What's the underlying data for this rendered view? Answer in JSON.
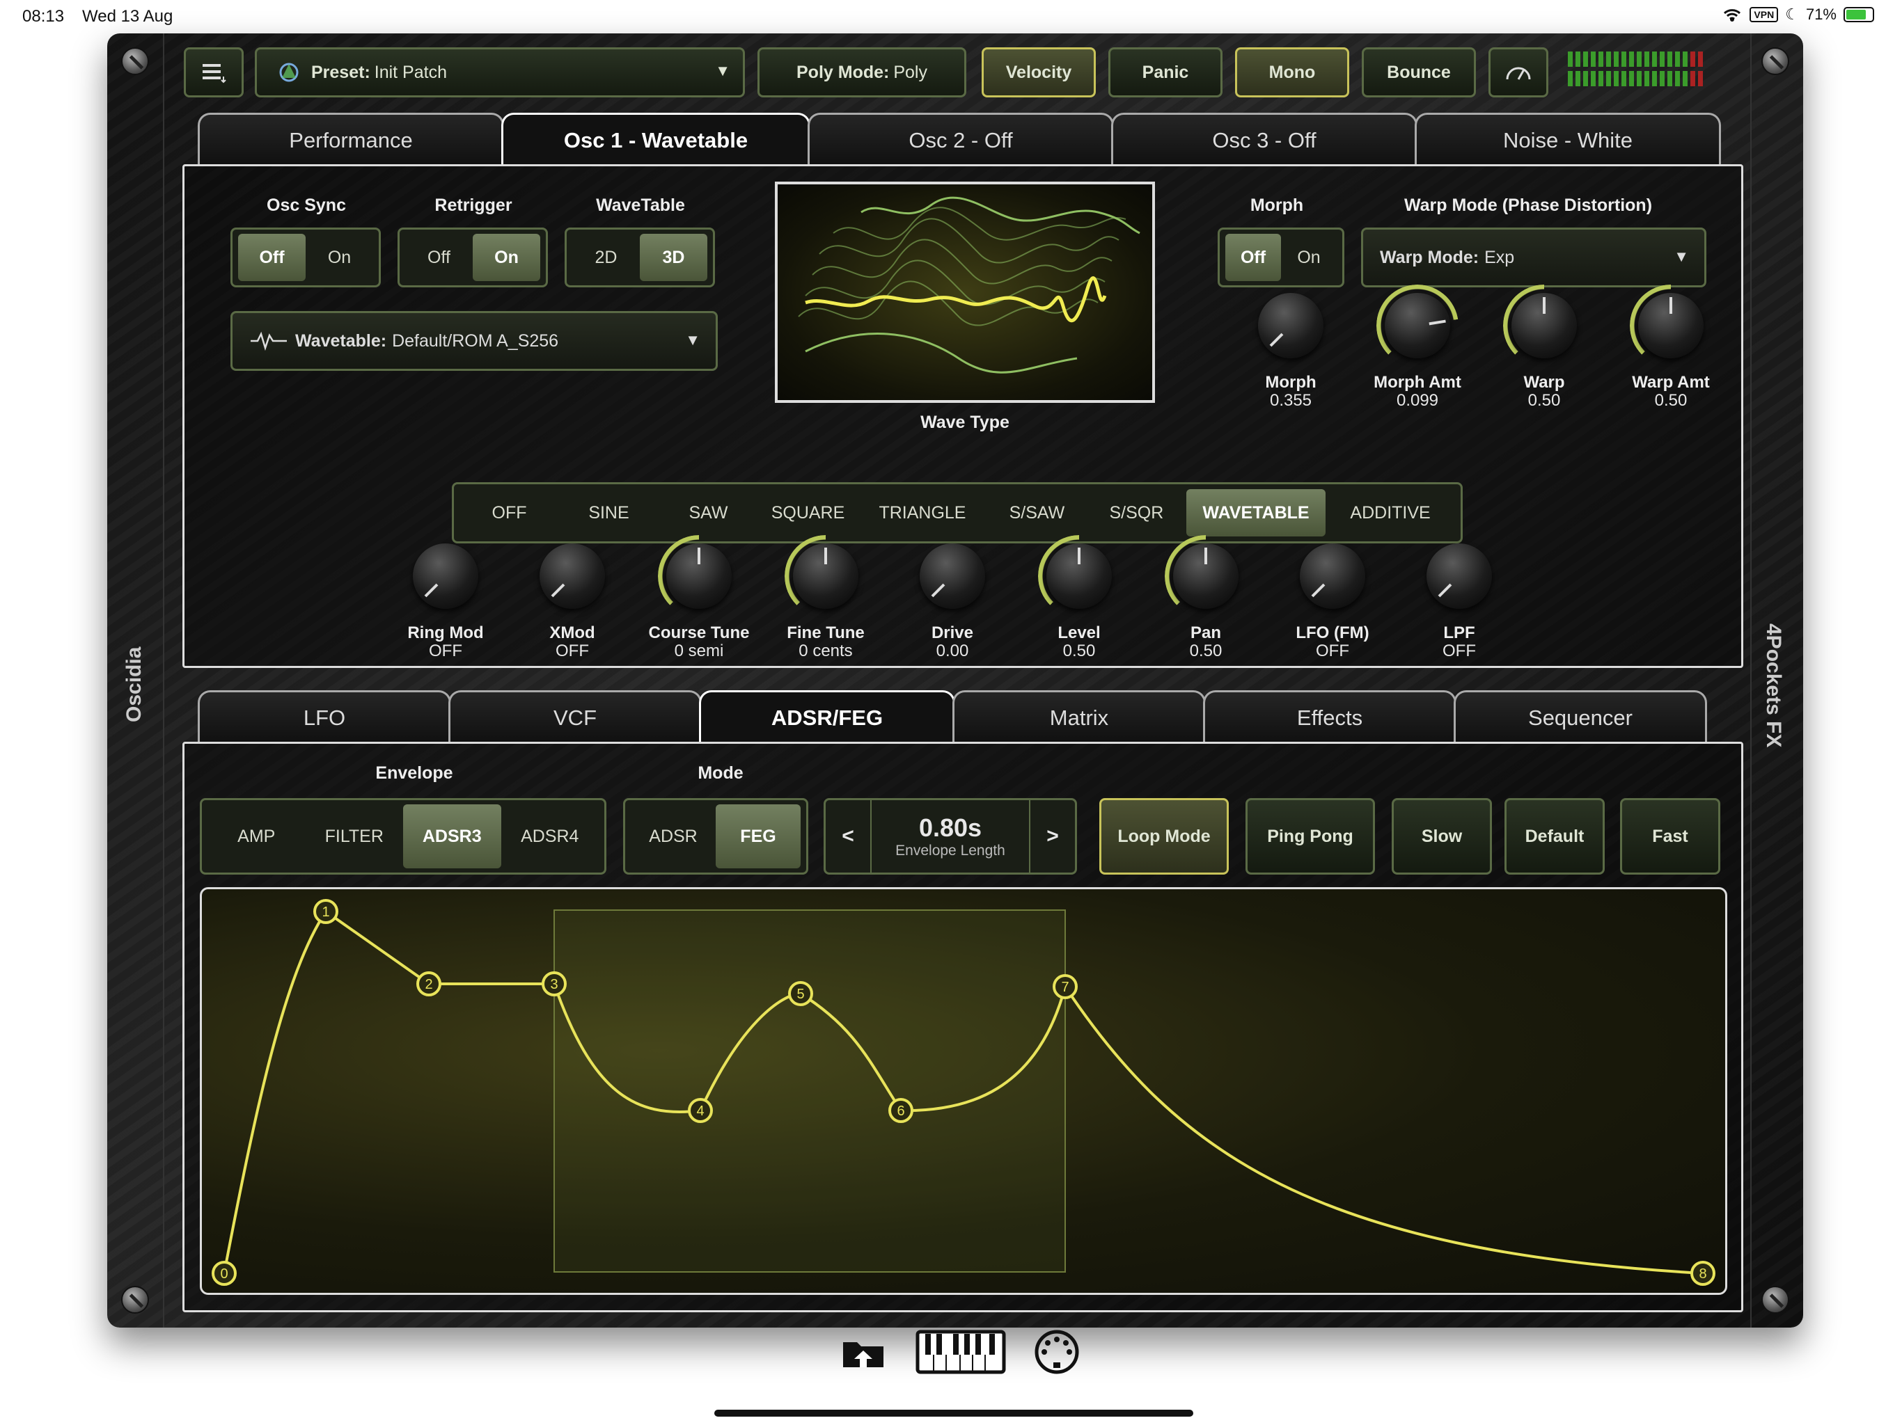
{
  "status": {
    "time": "08:13",
    "date": "Wed 13 Aug",
    "vpn": "VPN",
    "battery": "71%"
  },
  "app": {
    "left_label": "Oscidia",
    "right_label": "4Pockets FX"
  },
  "topbar": {
    "preset_label": "Preset:",
    "preset_value": "Init Patch",
    "poly_label": "Poly Mode:",
    "poly_value": "Poly",
    "velocity": "Velocity",
    "panic": "Panic",
    "mono": "Mono",
    "bounce": "Bounce"
  },
  "osc_tabs": [
    "Performance",
    "Osc 1 - Wavetable",
    "Osc 2 - Off",
    "Osc 3 - Off",
    "Noise - White"
  ],
  "osc": {
    "osc_sync": {
      "label": "Osc Sync",
      "options": [
        "Off",
        "On"
      ],
      "selected": "Off"
    },
    "retrigger": {
      "label": "Retrigger",
      "options": [
        "Off",
        "On"
      ],
      "selected": "On"
    },
    "wavetable_mode": {
      "label": "WaveTable",
      "options": [
        "2D",
        "3D"
      ],
      "selected": "3D"
    },
    "wavetable_label": "Wavetable:",
    "wavetable_value": "Default/ROM A_S256",
    "wave_type_label": "Wave Type",
    "wave_types": [
      "OFF",
      "SINE",
      "SAW",
      "SQUARE",
      "TRIANGLE",
      "S/SAW",
      "S/SQR",
      "WAVETABLE",
      "ADDITIVE"
    ],
    "wave_type_selected": "WAVETABLE",
    "morph": {
      "label": "Morph",
      "options": [
        "Off",
        "On"
      ],
      "selected": "Off"
    },
    "warp_mode_label": "Warp Mode (Phase Distortion)",
    "warp_mode_prefix": "Warp Mode:",
    "warp_mode_value": "Exp",
    "top_knobs": [
      {
        "name": "Morph",
        "value": "0.355",
        "level": 0.0
      },
      {
        "name": "Morph Amt",
        "value": "0.099",
        "level": 0.8
      },
      {
        "name": "Warp",
        "value": "0.50",
        "level": 0.5
      },
      {
        "name": "Warp Amt",
        "value": "0.50",
        "level": 0.5
      }
    ],
    "knobs": [
      {
        "name": "Ring Mod",
        "value": "OFF",
        "level": 0.0
      },
      {
        "name": "XMod",
        "value": "OFF",
        "level": 0.0
      },
      {
        "name": "Course Tune",
        "value": "0 semi",
        "level": 0.5
      },
      {
        "name": "Fine Tune",
        "value": "0 cents",
        "level": 0.5
      },
      {
        "name": "Drive",
        "value": "0.00",
        "level": 0.0
      },
      {
        "name": "Level",
        "value": "0.50",
        "level": 0.5
      },
      {
        "name": "Pan",
        "value": "0.50",
        "level": 0.5
      },
      {
        "name": "LFO (FM)",
        "value": "OFF",
        "level": 0.0
      },
      {
        "name": "LPF",
        "value": "OFF",
        "level": 0.0
      }
    ]
  },
  "mod_tabs": [
    "LFO",
    "VCF",
    "ADSR/FEG",
    "Matrix",
    "Effects",
    "Sequencer"
  ],
  "env": {
    "envelope_label": "Envelope",
    "envelope_options": [
      "AMP",
      "FILTER",
      "ADSR3",
      "ADSR4"
    ],
    "envelope_selected": "ADSR3",
    "mode_label": "Mode",
    "mode_options": [
      "ADSR",
      "FEG"
    ],
    "mode_selected": "FEG",
    "length_value": "0.80s",
    "length_label": "Envelope Length",
    "prev": "<",
    "next": ">",
    "loop_mode": "Loop Mode",
    "ping_pong": "Ping Pong",
    "slow": "Slow",
    "default": "Default",
    "fast": "Fast",
    "points": [
      "0",
      "1",
      "2",
      "3",
      "4",
      "5",
      "6",
      "7",
      "8"
    ]
  },
  "colors": {
    "accent": "#c8c35a",
    "envelope_line": "#e8e35a",
    "wave_green": "#8fbf62"
  },
  "icons": {
    "folder": "folder-icon",
    "keyboard": "keyboard-icon",
    "midi": "midi-icon"
  }
}
